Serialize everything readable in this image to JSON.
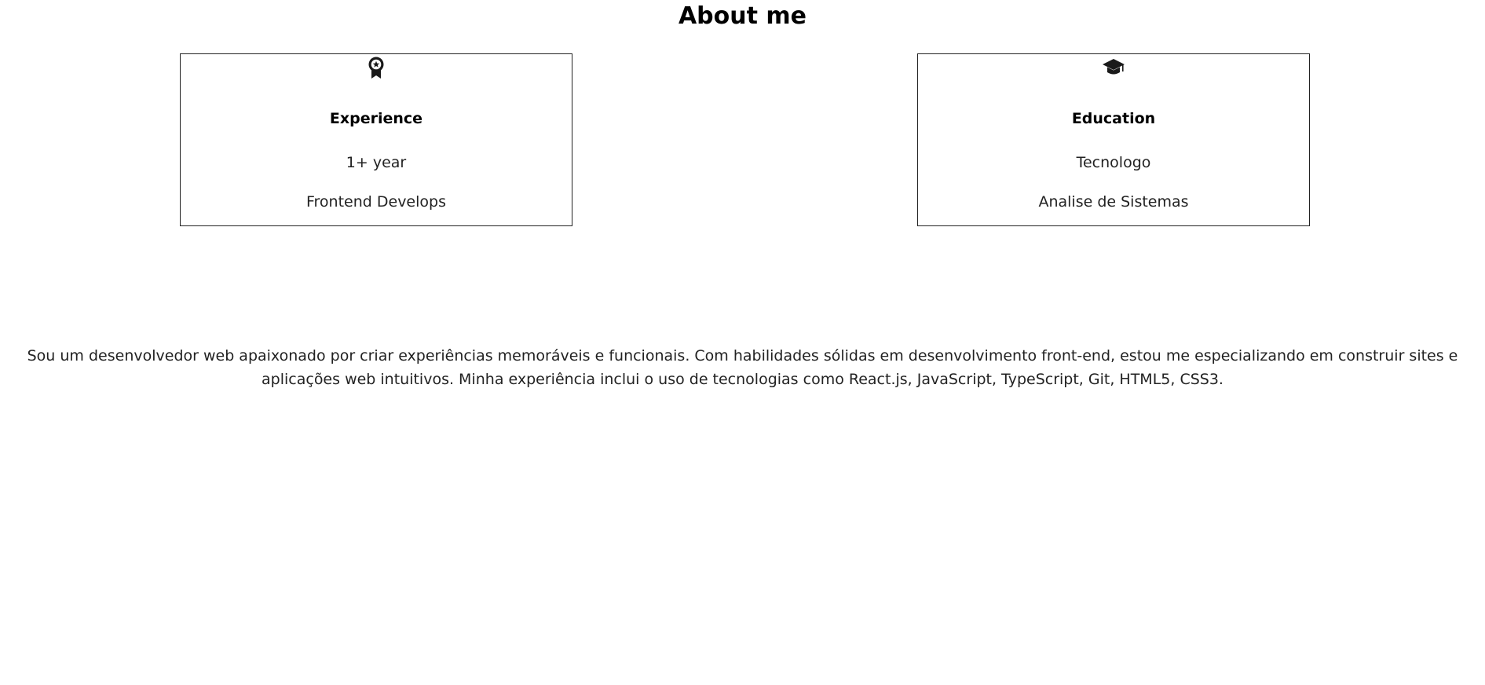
{
  "page": {
    "title": "About me"
  },
  "cards": {
    "experience": {
      "icon": "award-medal-icon",
      "title": "Experience",
      "line1": "1+ year",
      "line2": "Frontend Develops"
    },
    "education": {
      "icon": "graduation-cap-icon",
      "title": "Education",
      "line1": "Tecnologo",
      "line2": "Analise de Sistemas"
    }
  },
  "bio": {
    "text": "Sou um desenvolvedor web apaixonado por criar experiências memoráveis e funcionais. Com habilidades sólidas em desenvolvimento front-end, estou me especializando em construir sites e aplicações web intuitivos. Minha experiência inclui o uso de tecnologias como React.js, JavaScript, TypeScript, Git, HTML5, CSS3."
  },
  "colors": {
    "border": "#222222",
    "text": "#1f1f1f",
    "background": "#ffffff"
  }
}
